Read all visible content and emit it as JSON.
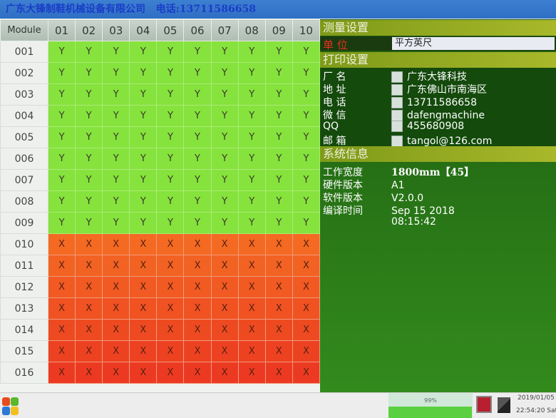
{
  "title": {
    "company": "广东大锋制鞋机械设备有限公司",
    "phone": "电话:13711586658"
  },
  "grid": {
    "header": "Module",
    "columns": [
      "01",
      "02",
      "03",
      "04",
      "05",
      "06",
      "07",
      "08",
      "09",
      "10"
    ],
    "rows": [
      {
        "id": "001",
        "v": "Y"
      },
      {
        "id": "002",
        "v": "Y"
      },
      {
        "id": "003",
        "v": "Y"
      },
      {
        "id": "004",
        "v": "Y"
      },
      {
        "id": "005",
        "v": "Y"
      },
      {
        "id": "006",
        "v": "Y"
      },
      {
        "id": "007",
        "v": "Y"
      },
      {
        "id": "008",
        "v": "Y"
      },
      {
        "id": "009",
        "v": "Y"
      },
      {
        "id": "010",
        "v": "X"
      },
      {
        "id": "011",
        "v": "X"
      },
      {
        "id": "012",
        "v": "X"
      },
      {
        "id": "013",
        "v": "X"
      },
      {
        "id": "014",
        "v": "X"
      },
      {
        "id": "015",
        "v": "X"
      },
      {
        "id": "016",
        "v": "X"
      }
    ]
  },
  "colors": {
    "ok": "#86e23c",
    "fail_top": "#f46a22",
    "fail_bottom": "#e63a22",
    "panel": "#2a7a18",
    "section": "#a8b82a"
  },
  "measure": {
    "title": "测量设置",
    "unit_label": "单  位",
    "unit_value": "平方英尺"
  },
  "print": {
    "title": "打印设置",
    "items": [
      {
        "label": "厂  名",
        "value": "广东大锋科技"
      },
      {
        "label": "地  址",
        "value": "广东佛山市南海区"
      },
      {
        "label": "电  话",
        "value": "13711586658"
      },
      {
        "label": "微  信",
        "value": "dafengmachine"
      },
      {
        "label": "QQ",
        "value": "455680908"
      },
      {
        "label": "邮  箱",
        "value": "tangol@126.com"
      }
    ]
  },
  "system": {
    "title": "系统信息",
    "items": [
      {
        "label": "工作宽度",
        "value": "1800mm【45】"
      },
      {
        "label": "硬件版本",
        "value": "A1"
      },
      {
        "label": "软件版本",
        "value": "V2.0.0"
      },
      {
        "label": "编译时间",
        "value": "Sep 15 2018"
      },
      {
        "label": "",
        "value": "08:15:42"
      }
    ]
  },
  "taskbar": {
    "progress_label": "99%",
    "progress": 99,
    "date": "2019/01/05",
    "time": "22:54:20 Sat"
  }
}
